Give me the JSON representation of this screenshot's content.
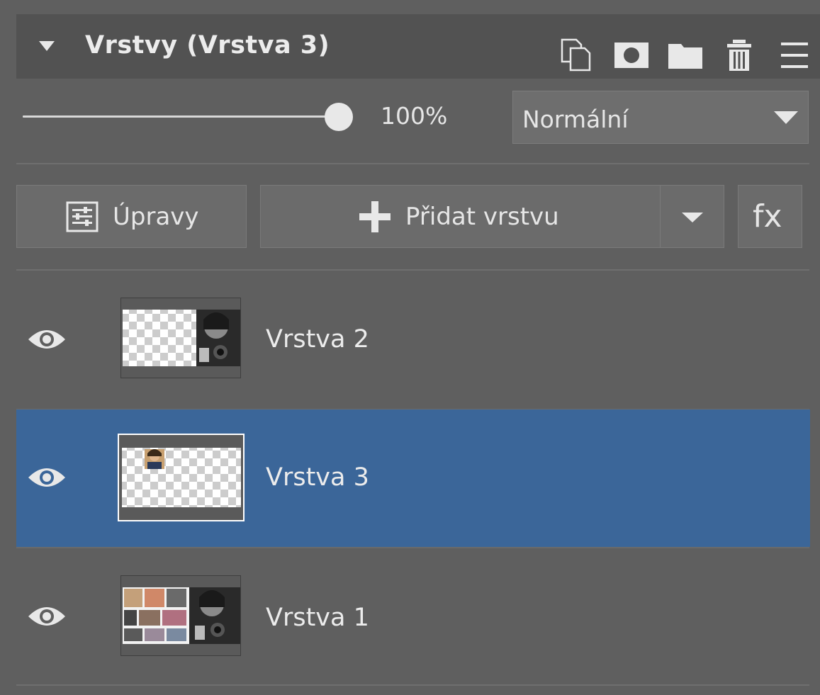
{
  "panel": {
    "title": "Vrstvy (Vrstva 3)",
    "header_icons": [
      "duplicate-icon",
      "mask-icon",
      "folder-icon",
      "trash-icon",
      "menu-icon"
    ]
  },
  "opacity": {
    "value_text": "100%",
    "value": 1.0
  },
  "blend_mode": {
    "selected": "Normální"
  },
  "toolbar": {
    "adjust_label": "Úpravy",
    "add_layer_label": "Přidat vrstvu",
    "fx_label": "fx"
  },
  "layers": [
    {
      "name": "Vrstva 2",
      "visible": true,
      "selected": false
    },
    {
      "name": "Vrstva 3",
      "visible": true,
      "selected": true
    },
    {
      "name": "Vrstva 1",
      "visible": true,
      "selected": false
    }
  ],
  "colors": {
    "panel_bg": "#5f5f5f",
    "header_bg": "#525252",
    "selected_row": "#3b6699",
    "text": "#e6e6e6"
  }
}
